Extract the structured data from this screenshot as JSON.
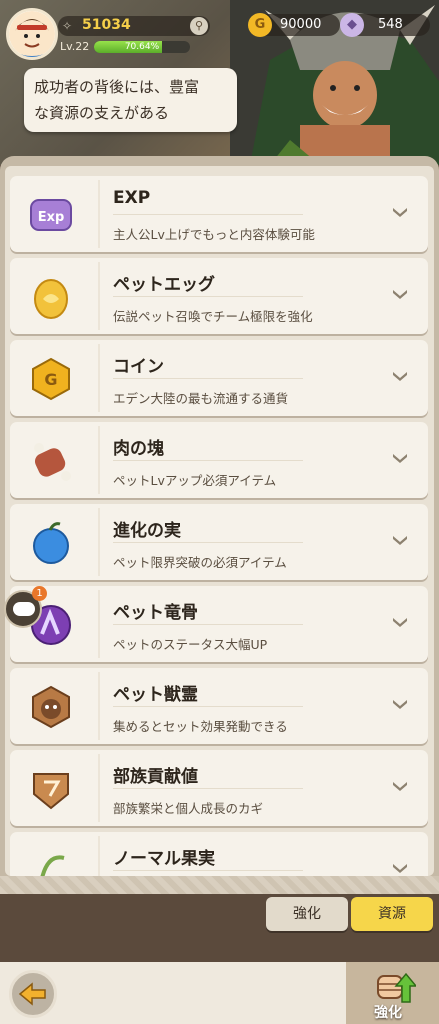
{
  "player": {
    "power": "51034",
    "level": "Lv.22",
    "xp_percent": "70.64%",
    "xp_fraction": 0.7064
  },
  "currencies": {
    "gold": "90000",
    "gems": "548"
  },
  "speech_bubble": {
    "line1": "成功者の背後には、豊富",
    "line2": "な資源の支えがある"
  },
  "resources": [
    {
      "name": "EXP",
      "desc": "主人公Lv上げでもっと内容体験可能",
      "icon": "exp-icon",
      "color": "#a77fd6"
    },
    {
      "name": "ペットエッグ",
      "desc": "伝説ペット召喚でチーム極限を強化",
      "icon": "pet-egg-icon",
      "color": "#f2c23b"
    },
    {
      "name": "コイン",
      "desc": "エデン大陸の最も流通する通貨",
      "icon": "coin-icon",
      "color": "#f0b21f"
    },
    {
      "name": "肉の塊",
      "desc": "ペットLvアップ必須アイテム",
      "icon": "meat-icon",
      "color": "#b5563d"
    },
    {
      "name": "進化の実",
      "desc": "ペット限界突破の必須アイテム",
      "icon": "evolution-fruit-icon",
      "color": "#3b8de0"
    },
    {
      "name": "ペット竜骨",
      "desc": "ペットのステータス大幅UP",
      "icon": "pet-dragon-bone-icon",
      "color": "#7d3fb3"
    },
    {
      "name": "ペット獣霊",
      "desc": "集めるとセット効果発動できる",
      "icon": "pet-beast-spirit-icon",
      "color": "#b87a45"
    },
    {
      "name": "部族貢献値",
      "desc": "部族繁栄と個人成長のカギ",
      "icon": "tribe-contribution-icon",
      "color": "#c98a4f"
    },
    {
      "name": "ノーマル果実",
      "desc": "",
      "icon": "normal-fruit-icon",
      "color": "#7aa84a"
    }
  ],
  "chat": {
    "badge": "1"
  },
  "tabs": {
    "enhance": "強化",
    "resources": "資源"
  },
  "powerup_button": {
    "label": "強化"
  }
}
